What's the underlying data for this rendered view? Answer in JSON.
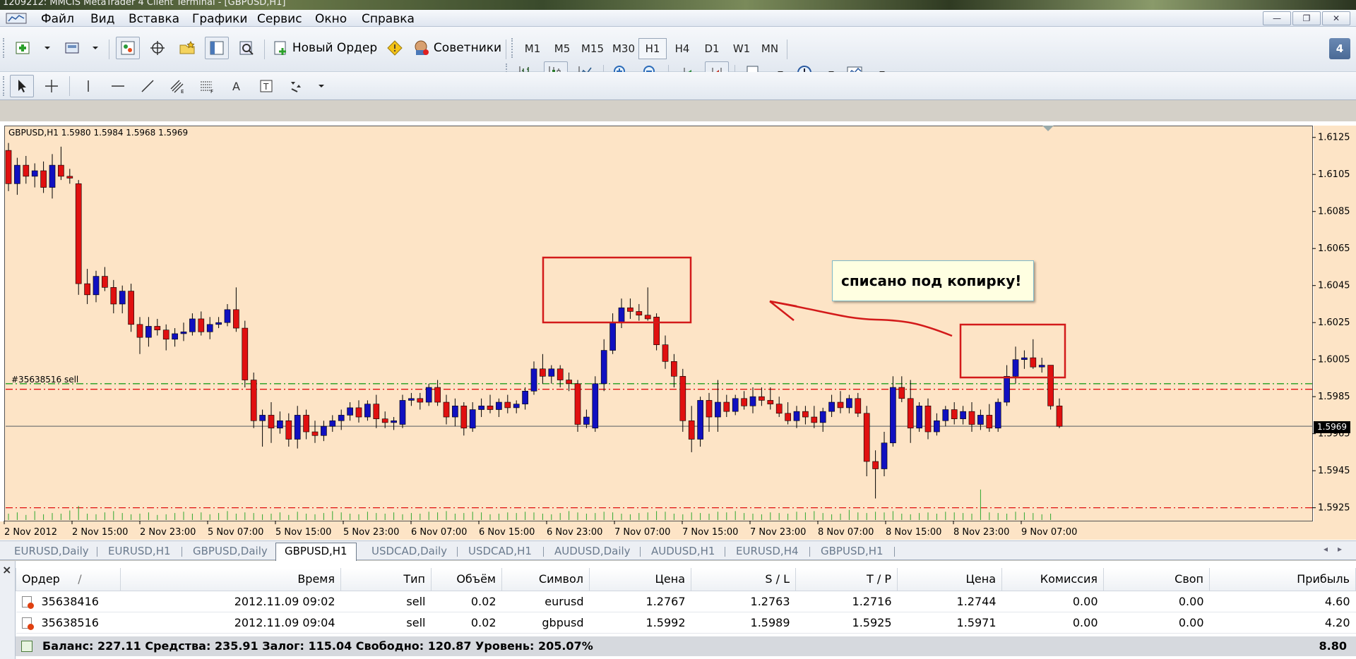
{
  "window": {
    "title": "1209212: MMCIS MetaTrader 4 Client Terminal - [GBPUSD,H1]",
    "badge": "4"
  },
  "menu": [
    "Файл",
    "Вид",
    "Вставка",
    "Графики",
    "Сервис",
    "Окно",
    "Справка"
  ],
  "toolbar": {
    "new_order_label": "Новый Ордер",
    "experts_label": "Советники",
    "timeframes": [
      "M1",
      "M5",
      "M15",
      "M30",
      "H1",
      "H4",
      "D1",
      "W1",
      "MN"
    ],
    "active_timeframe": "H1"
  },
  "chart": {
    "header": "GBPUSD,H1  1.5980 1.5984 1.5968 1.5969",
    "order_line_label": "#35638516 sell",
    "current_price": "1.5969",
    "annotation": "списано под копирку!",
    "colors": {
      "background": "#fde4c6",
      "bull": "#1010c0",
      "bear": "#e01010",
      "sl_line": "#e01010",
      "tp_line": "#20a020",
      "marker": "#e01010"
    }
  },
  "chart_data": {
    "type": "candlestick",
    "symbol": "GBPUSD",
    "timeframe": "H1",
    "y_ticks": [
      "1.6125",
      "1.6105",
      "1.6085",
      "1.6065",
      "1.6045",
      "1.6025",
      "1.6005",
      "1.5985",
      "1.5965",
      "1.5945",
      "1.5925"
    ],
    "x_ticks": [
      "2 Nov 2012",
      "2 Nov 15:00",
      "2 Nov 23:00",
      "5 Nov 07:00",
      "5 Nov 15:00",
      "5 Nov 23:00",
      "6 Nov 07:00",
      "6 Nov 15:00",
      "6 Nov 23:00",
      "7 Nov 07:00",
      "7 Nov 15:00",
      "7 Nov 23:00",
      "8 Nov 07:00",
      "8 Nov 15:00",
      "8 Nov 23:00",
      "9 Nov 07:00"
    ],
    "ylim": [
      1.5918,
      1.6131
    ],
    "current_price": 1.5969,
    "order_lines": {
      "open": 1.5992,
      "stop_loss": 1.5989,
      "take_profit": 1.5925
    },
    "candles": [
      [
        1.6118,
        1.6122,
        1.6096,
        1.61
      ],
      [
        1.61,
        1.6114,
        1.6094,
        1.611
      ],
      [
        1.611,
        1.6115,
        1.61,
        1.6104
      ],
      [
        1.6104,
        1.6111,
        1.6098,
        1.6107
      ],
      [
        1.6107,
        1.6112,
        1.6095,
        1.6098
      ],
      [
        1.6098,
        1.6116,
        1.6092,
        1.611
      ],
      [
        1.611,
        1.612,
        1.6102,
        1.6104
      ],
      [
        1.6104,
        1.6108,
        1.61,
        1.6103
      ],
      [
        1.61,
        1.6102,
        1.604,
        1.6046
      ],
      [
        1.6046,
        1.6054,
        1.6035,
        1.604
      ],
      [
        1.604,
        1.6053,
        1.6036,
        1.605
      ],
      [
        1.605,
        1.6055,
        1.6042,
        1.6044
      ],
      [
        1.6044,
        1.6048,
        1.603,
        1.6035
      ],
      [
        1.6035,
        1.6045,
        1.603,
        1.6042
      ],
      [
        1.6042,
        1.6046,
        1.602,
        1.6024
      ],
      [
        1.6024,
        1.6028,
        1.6008,
        1.6017
      ],
      [
        1.6017,
        1.6028,
        1.6012,
        1.6023
      ],
      [
        1.6023,
        1.6027,
        1.6018,
        1.6021
      ],
      [
        1.6021,
        1.6024,
        1.601,
        1.6016
      ],
      [
        1.6016,
        1.6022,
        1.6012,
        1.6019
      ],
      [
        1.6019,
        1.6025,
        1.6015,
        1.602
      ],
      [
        1.602,
        1.603,
        1.6018,
        1.6027
      ],
      [
        1.6027,
        1.6031,
        1.6018,
        1.602
      ],
      [
        1.602,
        1.6028,
        1.6016,
        1.6024
      ],
      [
        1.6024,
        1.6028,
        1.6022,
        1.6025
      ],
      [
        1.6025,
        1.6035,
        1.6023,
        1.6032
      ],
      [
        1.6032,
        1.6044,
        1.602,
        1.6022
      ],
      [
        1.6022,
        1.6026,
        1.599,
        1.5994
      ],
      [
        1.5994,
        1.5998,
        1.5968,
        1.5972
      ],
      [
        1.5972,
        1.5978,
        1.5958,
        1.5975
      ],
      [
        1.5975,
        1.5982,
        1.596,
        1.5968
      ],
      [
        1.5968,
        1.5977,
        1.5965,
        1.5972
      ],
      [
        1.5972,
        1.5976,
        1.5958,
        1.5962
      ],
      [
        1.5962,
        1.598,
        1.5957,
        1.5975
      ],
      [
        1.5975,
        1.5978,
        1.5962,
        1.5966
      ],
      [
        1.5966,
        1.5972,
        1.596,
        1.5964
      ],
      [
        1.5964,
        1.5972,
        1.5961,
        1.5969
      ],
      [
        1.5969,
        1.5975,
        1.5966,
        1.5972
      ],
      [
        1.5972,
        1.5978,
        1.5967,
        1.5975
      ],
      [
        1.5975,
        1.5982,
        1.5972,
        1.5979
      ],
      [
        1.5979,
        1.5983,
        1.5971,
        1.5974
      ],
      [
        1.5974,
        1.5983,
        1.5972,
        1.5981
      ],
      [
        1.5981,
        1.5986,
        1.5968,
        1.5973
      ],
      [
        1.5973,
        1.5977,
        1.5968,
        1.5971
      ],
      [
        1.5971,
        1.5974,
        1.5967,
        1.5972
      ],
      [
        1.597,
        1.5986,
        1.5968,
        1.5983
      ],
      [
        1.5983,
        1.5987,
        1.598,
        1.5984
      ],
      [
        1.5984,
        1.5987,
        1.5978,
        1.5982
      ],
      [
        1.5982,
        1.5992,
        1.598,
        1.599
      ],
      [
        1.599,
        1.5994,
        1.598,
        1.5982
      ],
      [
        1.5982,
        1.5986,
        1.597,
        1.5974
      ],
      [
        1.5974,
        1.5984,
        1.5969,
        1.598
      ],
      [
        1.598,
        1.5982,
        1.5964,
        1.5968
      ],
      [
        1.5968,
        1.5982,
        1.5966,
        1.5978
      ],
      [
        1.5978,
        1.5984,
        1.5974,
        1.598
      ],
      [
        1.598,
        1.5986,
        1.5976,
        1.5978
      ],
      [
        1.5978,
        1.5984,
        1.5974,
        1.5982
      ],
      [
        1.5982,
        1.5986,
        1.5976,
        1.5979
      ],
      [
        1.5979,
        1.5983,
        1.5976,
        1.5981
      ],
      [
        1.5981,
        1.599,
        1.5978,
        1.5988
      ],
      [
        1.5988,
        1.6004,
        1.5986,
        1.6
      ],
      [
        1.6,
        1.6008,
        1.5992,
        1.5996
      ],
      [
        1.5996,
        1.6002,
        1.5992,
        1.6
      ],
      [
        1.6,
        1.6002,
        1.599,
        1.5994
      ],
      [
        1.5994,
        1.5998,
        1.5988,
        1.5992
      ],
      [
        1.5992,
        1.5994,
        1.5966,
        1.597
      ],
      [
        1.597,
        1.5978,
        1.5968,
        1.5974
      ],
      [
        1.5968,
        1.5996,
        1.5966,
        1.5992
      ],
      [
        1.5992,
        1.6016,
        1.5988,
        1.601
      ],
      [
        1.601,
        1.603,
        1.6008,
        1.6025
      ],
      [
        1.6025,
        1.6038,
        1.6022,
        1.6033
      ],
      [
        1.6033,
        1.6038,
        1.6027,
        1.6031
      ],
      [
        1.6031,
        1.6035,
        1.6026,
        1.6029
      ],
      [
        1.6029,
        1.6044,
        1.6026,
        1.6027
      ],
      [
        1.6028,
        1.603,
        1.601,
        1.6013
      ],
      [
        1.6013,
        1.6018,
        1.6,
        1.6004
      ],
      [
        1.6004,
        1.6008,
        1.599,
        1.5996
      ],
      [
        1.5996,
        1.6,
        1.5966,
        1.5972
      ],
      [
        1.5972,
        1.598,
        1.5955,
        1.5962
      ],
      [
        1.5962,
        1.5985,
        1.5958,
        1.5983
      ],
      [
        1.5983,
        1.5987,
        1.5966,
        1.5974
      ],
      [
        1.5974,
        1.5994,
        1.5966,
        1.5982
      ],
      [
        1.5982,
        1.5986,
        1.5974,
        1.5977
      ],
      [
        1.5977,
        1.5986,
        1.5975,
        1.5984
      ],
      [
        1.5984,
        1.5988,
        1.5978,
        1.598
      ],
      [
        1.598,
        1.599,
        1.5976,
        1.5985
      ],
      [
        1.5985,
        1.599,
        1.598,
        1.5983
      ],
      [
        1.5983,
        1.599,
        1.5978,
        1.5981
      ],
      [
        1.5981,
        1.5985,
        1.5974,
        1.5976
      ],
      [
        1.5976,
        1.5982,
        1.597,
        1.5972
      ],
      [
        1.5972,
        1.598,
        1.5968,
        1.5977
      ],
      [
        1.5977,
        1.598,
        1.597,
        1.5974
      ],
      [
        1.5974,
        1.598,
        1.5968,
        1.5971
      ],
      [
        1.5971,
        1.5979,
        1.5966,
        1.5977
      ],
      [
        1.5977,
        1.5986,
        1.5974,
        1.5982
      ],
      [
        1.5982,
        1.5988,
        1.5976,
        1.5979
      ],
      [
        1.5979,
        1.5986,
        1.5976,
        1.5984
      ],
      [
        1.5984,
        1.5987,
        1.5974,
        1.5976
      ],
      [
        1.5976,
        1.598,
        1.5942,
        1.595
      ],
      [
        1.595,
        1.5956,
        1.593,
        1.5946
      ],
      [
        1.5946,
        1.5966,
        1.5942,
        1.596
      ],
      [
        1.596,
        1.5996,
        1.5958,
        1.599
      ],
      [
        1.599,
        1.5996,
        1.5982,
        1.5984
      ],
      [
        1.5984,
        1.5994,
        1.596,
        1.5968
      ],
      [
        1.5968,
        1.5982,
        1.5966,
        1.598
      ],
      [
        1.598,
        1.5984,
        1.5962,
        1.5966
      ],
      [
        1.5966,
        1.5976,
        1.5964,
        1.5972
      ],
      [
        1.5972,
        1.598,
        1.5969,
        1.5978
      ],
      [
        1.5978,
        1.5982,
        1.597,
        1.5973
      ],
      [
        1.5973,
        1.598,
        1.597,
        1.5977
      ],
      [
        1.5977,
        1.5982,
        1.5966,
        1.597
      ],
      [
        1.597,
        1.5978,
        1.5967,
        1.5975
      ],
      [
        1.5975,
        1.5981,
        1.5966,
        1.5968
      ],
      [
        1.5968,
        1.5984,
        1.5966,
        1.5982
      ],
      [
        1.5982,
        1.6002,
        1.598,
        1.5996
      ],
      [
        1.5996,
        1.6012,
        1.5992,
        1.6005
      ],
      [
        1.6005,
        1.601,
        1.6,
        1.6006
      ],
      [
        1.6006,
        1.6016,
        1.6,
        1.6001
      ],
      [
        1.6001,
        1.6006,
        1.5998,
        1.6002
      ],
      [
        1.6002,
        1.6002,
        1.5978,
        1.598
      ],
      [
        1.598,
        1.5984,
        1.5968,
        1.5969
      ]
    ],
    "volumes": [
      10,
      12,
      8,
      14,
      9,
      11,
      10,
      15,
      22,
      10,
      9,
      12,
      14,
      11,
      9,
      10,
      12,
      8,
      9,
      11,
      13,
      10,
      12,
      9,
      11,
      14,
      10,
      12,
      11,
      9,
      10,
      12,
      8,
      13,
      10,
      9,
      11,
      14,
      12,
      10,
      9,
      13,
      11,
      10,
      12,
      9,
      11,
      10,
      13,
      12,
      14,
      10,
      11,
      13,
      12,
      9,
      10,
      12,
      11,
      13,
      12,
      10,
      9,
      11,
      14,
      12,
      10,
      11,
      13,
      12,
      10,
      9,
      11,
      12,
      14,
      13,
      10,
      9,
      12,
      11,
      10,
      13,
      12,
      14,
      11,
      10,
      9,
      12,
      11,
      10,
      13,
      12,
      14,
      11,
      9,
      10,
      16,
      12,
      11,
      13,
      12,
      14,
      10,
      9,
      11,
      12,
      10,
      13,
      12,
      11,
      10,
      48,
      12,
      11,
      10,
      13,
      12,
      11,
      9,
      10
    ]
  },
  "chart_tabs": [
    "EURUSD,Daily",
    "EURUSD,H1",
    "GBPUSD,Daily",
    "GBPUSD,H1",
    "USDCAD,Daily",
    "USDCAD,H1",
    "AUDUSD,Daily",
    "AUDUSD,H1",
    "EURUSD,H4",
    "GBPUSD,H1"
  ],
  "active_chart_tab": 3,
  "terminal": {
    "columns": [
      "Ордер",
      "/",
      "Время",
      "Тип",
      "Объём",
      "Символ",
      "Цена",
      "S / L",
      "T / P",
      "Цена",
      "Комиссия",
      "Своп",
      "Прибыль"
    ],
    "rows": [
      {
        "order": "35638416",
        "time": "2012.11.09 09:02",
        "type": "sell",
        "volume": "0.02",
        "symbol": "eurusd",
        "price": "1.2767",
        "sl": "1.2763",
        "tp": "1.2716",
        "cur": "1.2744",
        "commission": "0.00",
        "swap": "0.00",
        "profit": "4.60"
      },
      {
        "order": "35638516",
        "time": "2012.11.09 09:04",
        "type": "sell",
        "volume": "0.02",
        "symbol": "gbpusd",
        "price": "1.5992",
        "sl": "1.5989",
        "tp": "1.5925",
        "cur": "1.5971",
        "commission": "0.00",
        "swap": "0.00",
        "profit": "4.20"
      }
    ],
    "balance_text": "Баланс: 227.11  Средства: 235.91  Залог: 115.04  Свободно: 120.87  Уровень: 205.07%",
    "total_profit": "8.80"
  }
}
